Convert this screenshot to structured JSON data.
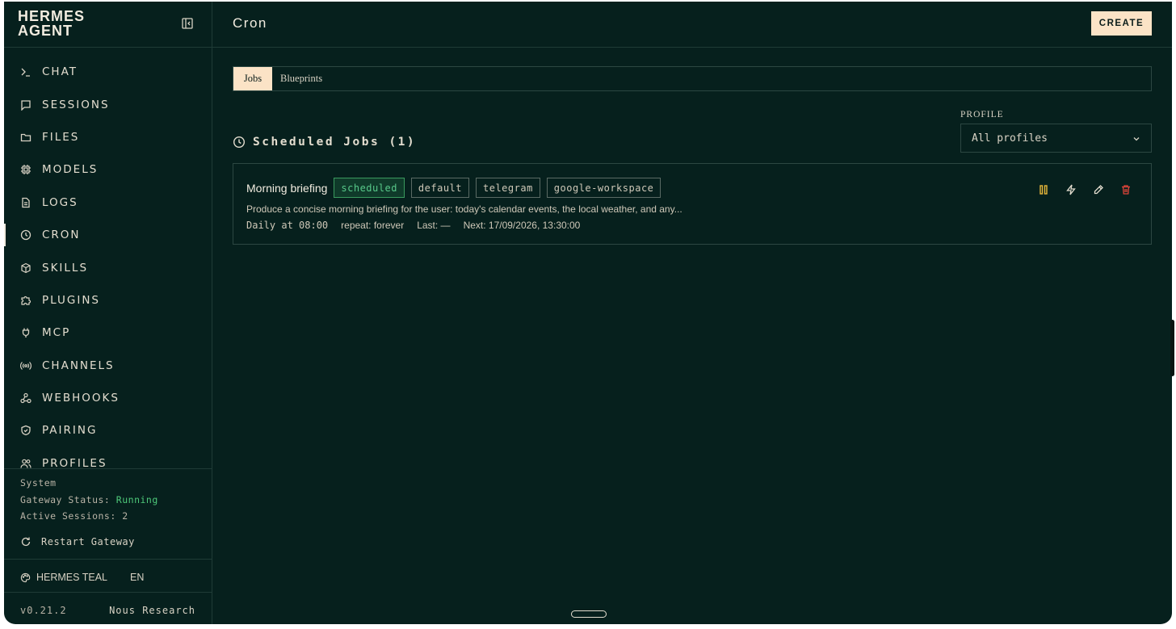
{
  "brand": {
    "line1": "HERMES",
    "line2": "AGENT"
  },
  "icons": {
    "collapse": "sidebar-collapse-icon",
    "restart": "refresh-icon",
    "theme": "palette-icon",
    "section": "clock-icon",
    "chevron": "chevron-down-icon",
    "pause": "pause-icon",
    "run": "lightning-icon",
    "edit": "pencil-icon",
    "delete": "trash-icon"
  },
  "nav": {
    "items": [
      {
        "label": "CHAT",
        "icon": "terminal-icon"
      },
      {
        "label": "SESSIONS",
        "icon": "message-square-icon"
      },
      {
        "label": "FILES",
        "icon": "folder-icon"
      },
      {
        "label": "MODELS",
        "icon": "cpu-icon"
      },
      {
        "label": "LOGS",
        "icon": "file-text-icon"
      },
      {
        "label": "CRON",
        "icon": "clock-icon",
        "active": true
      },
      {
        "label": "SKILLS",
        "icon": "package-icon"
      },
      {
        "label": "PLUGINS",
        "icon": "puzzle-icon"
      },
      {
        "label": "MCP",
        "icon": "plug-icon"
      },
      {
        "label": "CHANNELS",
        "icon": "radio-icon"
      },
      {
        "label": "WEBHOOKS",
        "icon": "webhook-icon"
      },
      {
        "label": "PAIRING",
        "icon": "shield-icon"
      },
      {
        "label": "PROFILES",
        "icon": "users-icon"
      }
    ]
  },
  "system": {
    "heading": "System",
    "gateway_label": "Gateway Status:",
    "gateway_value": "Running",
    "sessions_label": "Active Sessions:",
    "sessions_value": "2",
    "restart_label": "Restart Gateway"
  },
  "theme": {
    "name": "HERMES TEAL",
    "lang": "EN"
  },
  "footer": {
    "version": "v0.21.2",
    "org": "Nous Research"
  },
  "header": {
    "title": "Cron",
    "create_label": "CREATE"
  },
  "tabs": {
    "jobs": "Jobs",
    "blueprints": "Blueprints"
  },
  "profile": {
    "label": "PROFILE",
    "value": "All profiles"
  },
  "section": {
    "title": "Scheduled Jobs (1)"
  },
  "colors": {
    "accent": "#fbe3c6",
    "background": "#06201d",
    "status_green": "#58c98a",
    "pause": "#e8b83a",
    "delete": "#e0453a"
  },
  "jobs": [
    {
      "name": "Morning briefing",
      "status": "scheduled",
      "tags": [
        "default",
        "telegram",
        "google-workspace"
      ],
      "description": "Produce a concise morning briefing for the user: today's calendar events, the local weather, and any...",
      "schedule": "Daily at 08:00",
      "repeat": "repeat: forever",
      "last": "Last: —",
      "next": "Next: 17/09/2026, 13:30:00"
    }
  ]
}
